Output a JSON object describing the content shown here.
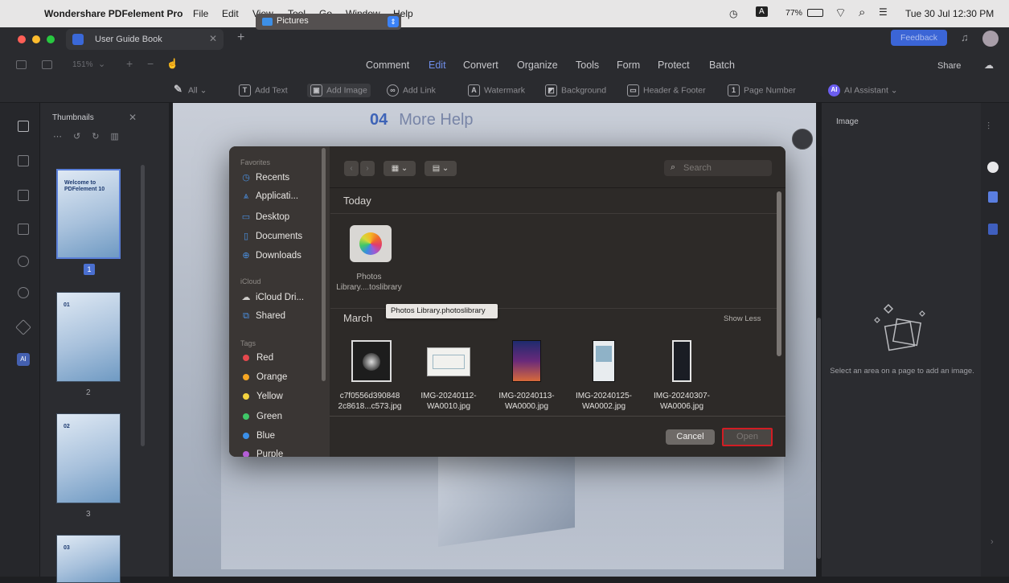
{
  "menubar": {
    "app_name": "Wondershare PDFelement Pro",
    "items": [
      "File",
      "Edit",
      "View",
      "Tool",
      "Go",
      "Window",
      "Help"
    ],
    "battery": "77%",
    "datetime": "Tue 30 Jul  12:30 PM"
  },
  "window": {
    "tab_title": "User Guide Book",
    "feedback_label": "Feedback",
    "share_label": "Share",
    "zoom": "151%"
  },
  "main_menu": {
    "items": [
      "Comment",
      "Edit",
      "Convert",
      "Organize",
      "Tools",
      "Form",
      "Protect",
      "Batch"
    ],
    "active": "Edit"
  },
  "edit_toolbar": {
    "all_label": "All",
    "add_text": "Add Text",
    "add_image": "Add Image",
    "add_link": "Add Link",
    "watermark": "Watermark",
    "background": "Background",
    "header_footer": "Header & Footer",
    "page_number": "Page Number",
    "ai_assistant": "AI Assistant"
  },
  "thumbnails": {
    "title": "Thumbnails",
    "pages": [
      "1",
      "2",
      "3"
    ],
    "thumb_titles": [
      "Welcome to PDFelement 10",
      "01",
      "02",
      "03"
    ]
  },
  "document": {
    "heading_num": "04",
    "heading_text": "More Help"
  },
  "right_panel": {
    "title": "Image",
    "hint": "Select an area on a page to add an image."
  },
  "dialog": {
    "favorites_label": "Favorites",
    "favorites": [
      "Recents",
      "Applicati...",
      "Desktop",
      "Documents",
      "Downloads"
    ],
    "icloud_label": "iCloud",
    "icloud": [
      "iCloud Dri...",
      "Shared"
    ],
    "tags_label": "Tags",
    "tags": [
      {
        "name": "Red",
        "color": "#e5484d"
      },
      {
        "name": "Orange",
        "color": "#f5a623"
      },
      {
        "name": "Yellow",
        "color": "#f4d33f"
      },
      {
        "name": "Green",
        "color": "#3fc768"
      },
      {
        "name": "Blue",
        "color": "#3b8fe8"
      },
      {
        "name": "Purple",
        "color": "#b45ed6"
      }
    ],
    "location": "Pictures",
    "search_placeholder": "Search",
    "section_today": "Today",
    "today_file": {
      "line1": "Photos",
      "line2": "Library....toslibrary"
    },
    "tooltip": "Photos Library.photoslibrary",
    "section_march": "March",
    "show_less": "Show Less",
    "march_files": [
      {
        "line1": "c7f0556d390848",
        "line2": "2c8618...c573.jpg"
      },
      {
        "line1": "IMG-20240112-",
        "line2": "WA0010.jpg"
      },
      {
        "line1": "IMG-20240113-",
        "line2": "WA0000.jpg"
      },
      {
        "line1": "IMG-20240125-",
        "line2": "WA0002.jpg"
      },
      {
        "line1": "IMG-20240307-",
        "line2": "WA0006.jpg"
      }
    ],
    "cancel_label": "Cancel",
    "open_label": "Open"
  },
  "colors": {
    "accent": "#3b82f6",
    "highlight": "#d21d24"
  }
}
